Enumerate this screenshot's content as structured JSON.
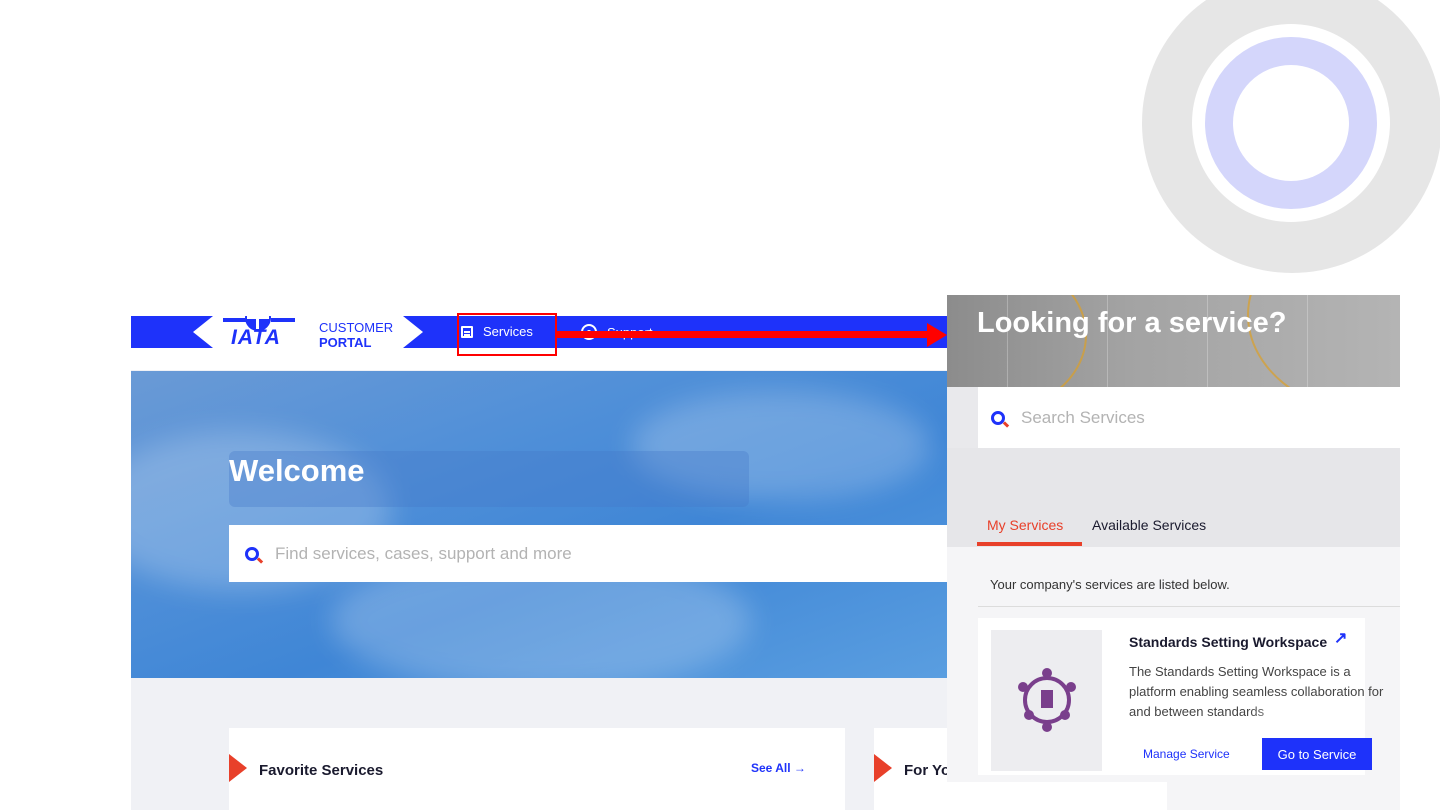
{
  "portal": {
    "logo": {
      "brand": "IATA",
      "line1": "CUSTOMER",
      "line2": "PORTAL"
    },
    "nav": {
      "services": "Services",
      "support": "Support"
    },
    "welcome": "Welcome",
    "search_placeholder": "Find services, cases, support and more",
    "cards": {
      "favorite_title": "Favorite Services",
      "see_all": "See All",
      "for_you_title": "For Yo"
    }
  },
  "panel": {
    "title": "Looking for a service?",
    "search_placeholder": "Search Services",
    "tabs": {
      "my": "My Services",
      "available": "Available Services"
    },
    "note": "Your company's services are listed below.",
    "service": {
      "title": "Standards Setting Workspace",
      "description": "The Standards Setting Workspace is a platform enabling seamless collaboration for and between standards",
      "manage": "Manage Service",
      "go": "Go to Service"
    }
  },
  "colors": {
    "brand_blue": "#1e32fa",
    "accent_red": "#e8402a",
    "highlight_red": "#ff0000",
    "ring_gray": "#e6e6e6",
    "ring_lavender": "#d4d6fb"
  },
  "icons": [
    "services-doc-icon",
    "support-help-icon",
    "search-icon",
    "arrow-right-icon",
    "external-link-icon",
    "standards-workspace-logo-icon"
  ]
}
